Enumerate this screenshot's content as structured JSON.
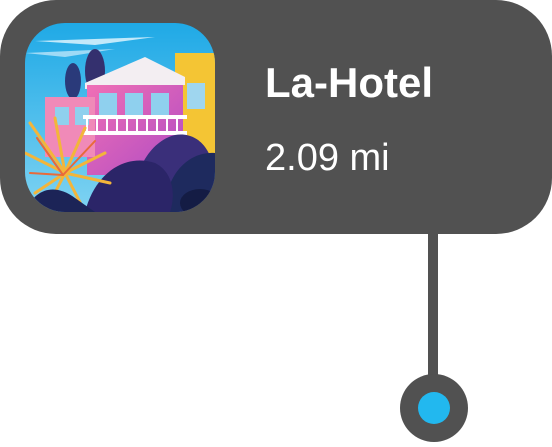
{
  "place": {
    "name": "La-Hotel",
    "distance": "2.09 mi",
    "thumbnail_icon": "hotel-illustration-icon"
  },
  "colors": {
    "card_background": "#515151",
    "text": "#ffffff",
    "pin_dot": "#22b8ef"
  }
}
